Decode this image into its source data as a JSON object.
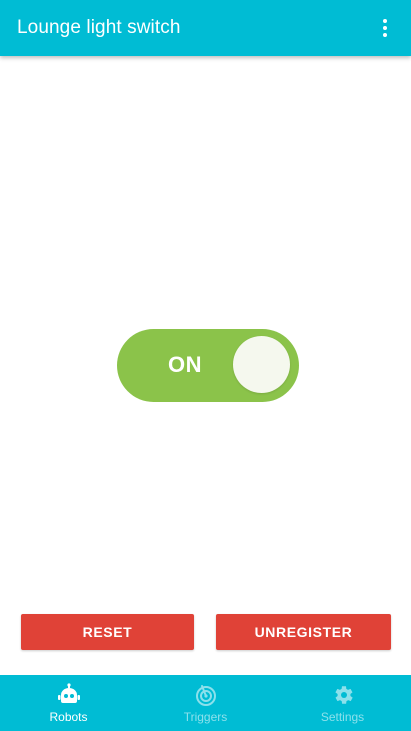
{
  "appbar": {
    "title": "Lounge light switch",
    "menu_icon": "more-vert-icon"
  },
  "toggle": {
    "label": "ON",
    "state": "on",
    "on_color": "#8bc34a"
  },
  "actions": {
    "reset_label": "RESET",
    "unregister_label": "UNREGISTER",
    "color": "#e04237"
  },
  "bottom_nav": {
    "selected": "robots",
    "items": [
      {
        "label": "Robots",
        "icon": "robot-icon"
      },
      {
        "label": "Triggers",
        "icon": "radar-icon"
      },
      {
        "label": "Settings",
        "icon": "gear-icon"
      }
    ],
    "background": "#00bcd4"
  }
}
